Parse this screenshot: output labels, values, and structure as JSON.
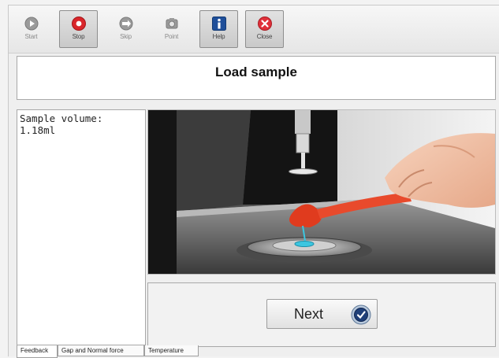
{
  "toolbar": {
    "buttons": [
      {
        "label": "Start",
        "icon": "play-icon",
        "state": "disabled"
      },
      {
        "label": "Stop",
        "icon": "stop-icon",
        "state": "active"
      },
      {
        "label": "Skip",
        "icon": "skip-icon",
        "state": "disabled"
      },
      {
        "label": "Point",
        "icon": "point-icon",
        "state": "disabled"
      },
      {
        "label": "Help",
        "icon": "info-icon",
        "state": "active"
      },
      {
        "label": "Close",
        "icon": "close-icon",
        "state": "normal"
      }
    ]
  },
  "title": "Load sample",
  "feedback": {
    "text": "Sample volume: 1.18ml"
  },
  "image": {
    "description_icon": "sample-loading-illustration"
  },
  "next_button": {
    "label": "Next",
    "icon": "next-arrow-icon"
  },
  "tabs": [
    {
      "label": "Feedback",
      "active": true
    },
    {
      "label": "Gap and Normal force",
      "active": false
    },
    {
      "label": "Temperature",
      "active": false
    }
  ],
  "colors": {
    "stop_red": "#d9262b",
    "help_blue": "#1f4f9a",
    "spoon_red": "#e03b1e",
    "sample_blue": "#3cc6e0"
  }
}
